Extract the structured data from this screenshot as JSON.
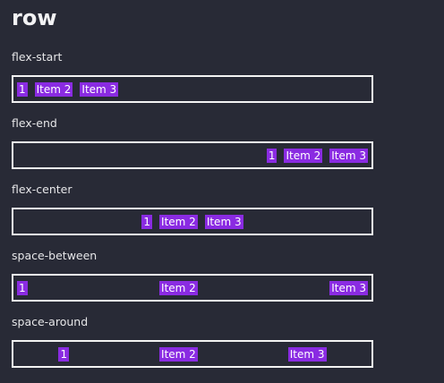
{
  "heading": "row",
  "sections": [
    {
      "label": "flex-start",
      "items": [
        "1",
        "Item 2",
        "Item 3"
      ]
    },
    {
      "label": "flex-end",
      "items": [
        "1",
        "Item 2",
        "Item 3"
      ]
    },
    {
      "label": "flex-center",
      "items": [
        "1",
        "Item 2",
        "Item 3"
      ]
    },
    {
      "label": "space-between",
      "items": [
        "1",
        "Item 2",
        "Item 3"
      ]
    },
    {
      "label": "space-around",
      "items": [
        "1",
        "Item 2",
        "Item 3"
      ]
    }
  ],
  "colors": {
    "background": "#282a36",
    "item": "#8a2be2",
    "border": "#f3f3f3"
  }
}
